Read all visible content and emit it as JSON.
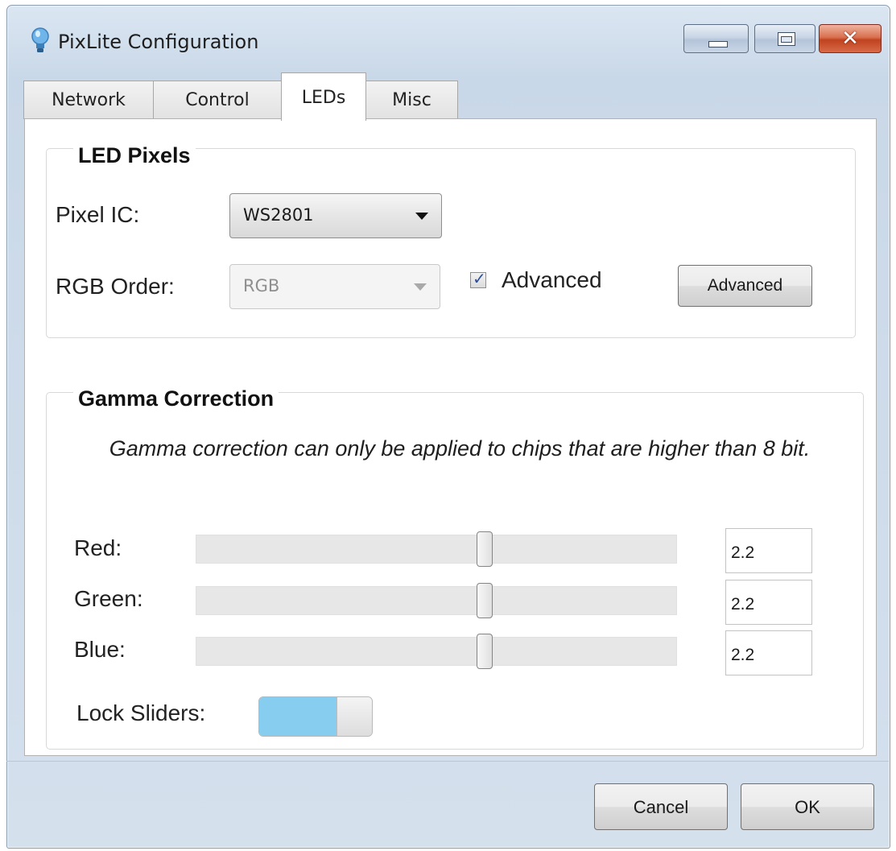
{
  "window": {
    "title": "PixLite Configuration",
    "close_glyph": "✕",
    "icons": {
      "app": "lightbulb-icon",
      "minimize": "minimize-icon",
      "maximize": "maximize-icon",
      "close": "close-icon"
    }
  },
  "tabs": [
    {
      "label": "Network",
      "active": false
    },
    {
      "label": "Control",
      "active": false
    },
    {
      "label": "LEDs",
      "active": true
    },
    {
      "label": "Misc",
      "active": false
    }
  ],
  "led_pixels": {
    "title": "LED Pixels",
    "pixel_ic": {
      "label": "Pixel IC:",
      "value": "WS2801"
    },
    "rgb_order": {
      "label": "RGB Order:",
      "value": "RGB",
      "enabled": false
    },
    "advanced_checkbox": {
      "label": "Advanced",
      "checked": true
    },
    "advanced_button": "Advanced"
  },
  "gamma": {
    "title": "Gamma Correction",
    "note": "Gamma correction can only be applied to chips that are higher than 8 bit.",
    "sliders": [
      {
        "label": "Red:",
        "value": "2.2",
        "position_fraction": 0.6
      },
      {
        "label": "Green:",
        "value": "2.2",
        "position_fraction": 0.6
      },
      {
        "label": "Blue:",
        "value": "2.2",
        "position_fraction": 0.6
      }
    ],
    "lock_sliders": {
      "label": "Lock Sliders:",
      "on": true
    }
  },
  "footer": {
    "cancel": "Cancel",
    "ok": "OK"
  },
  "colors": {
    "toggle_on": "#86cdef",
    "close_button": "#c9492a",
    "frame": "#c9d8e8"
  }
}
